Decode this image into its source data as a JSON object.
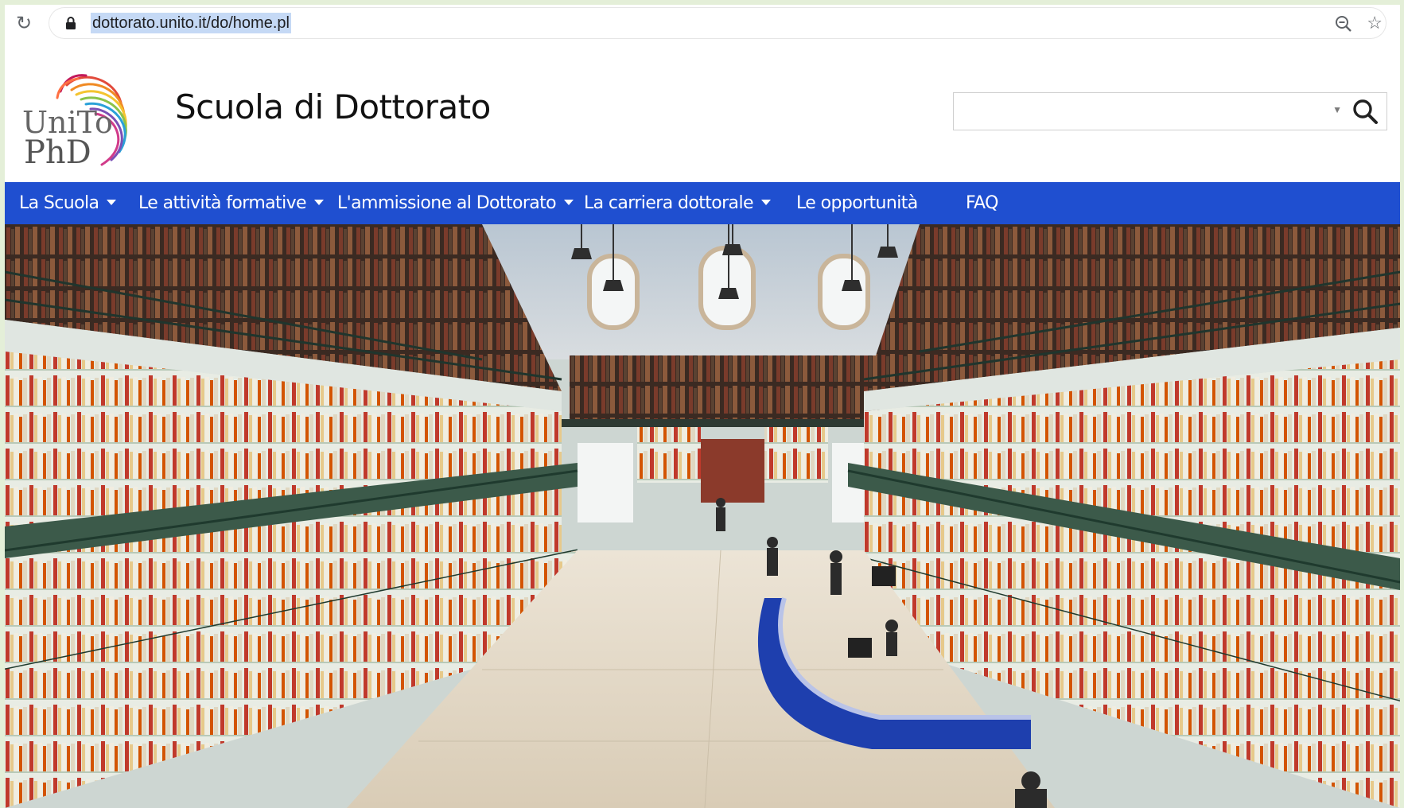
{
  "browser": {
    "url": "dottorato.unito.it/do/home.pl",
    "icons": [
      "reload-icon",
      "lock-icon",
      "zoom-icon",
      "star-icon"
    ]
  },
  "header": {
    "logo_text_line1": "UniTo",
    "logo_text_line2": "PhD",
    "title": "Scuola di Dottorato",
    "search": {
      "value": "",
      "placeholder": ""
    }
  },
  "nav": {
    "items": [
      {
        "label": "La Scuola",
        "dropdown": true
      },
      {
        "label": "Le attività formative",
        "dropdown": true
      },
      {
        "label": "L'ammissione al Dottorato",
        "dropdown": true
      },
      {
        "label": "La carriera dottorale",
        "dropdown": true
      },
      {
        "label": "Le opportunità",
        "dropdown": false
      },
      {
        "label": "FAQ",
        "dropdown": false
      }
    ]
  },
  "hero": {
    "subject": "library-reading-room-photo"
  },
  "colors": {
    "nav_background": "#1f4fd0",
    "url_highlight": "#c5d9f5",
    "page_border": "#e4efd8"
  }
}
